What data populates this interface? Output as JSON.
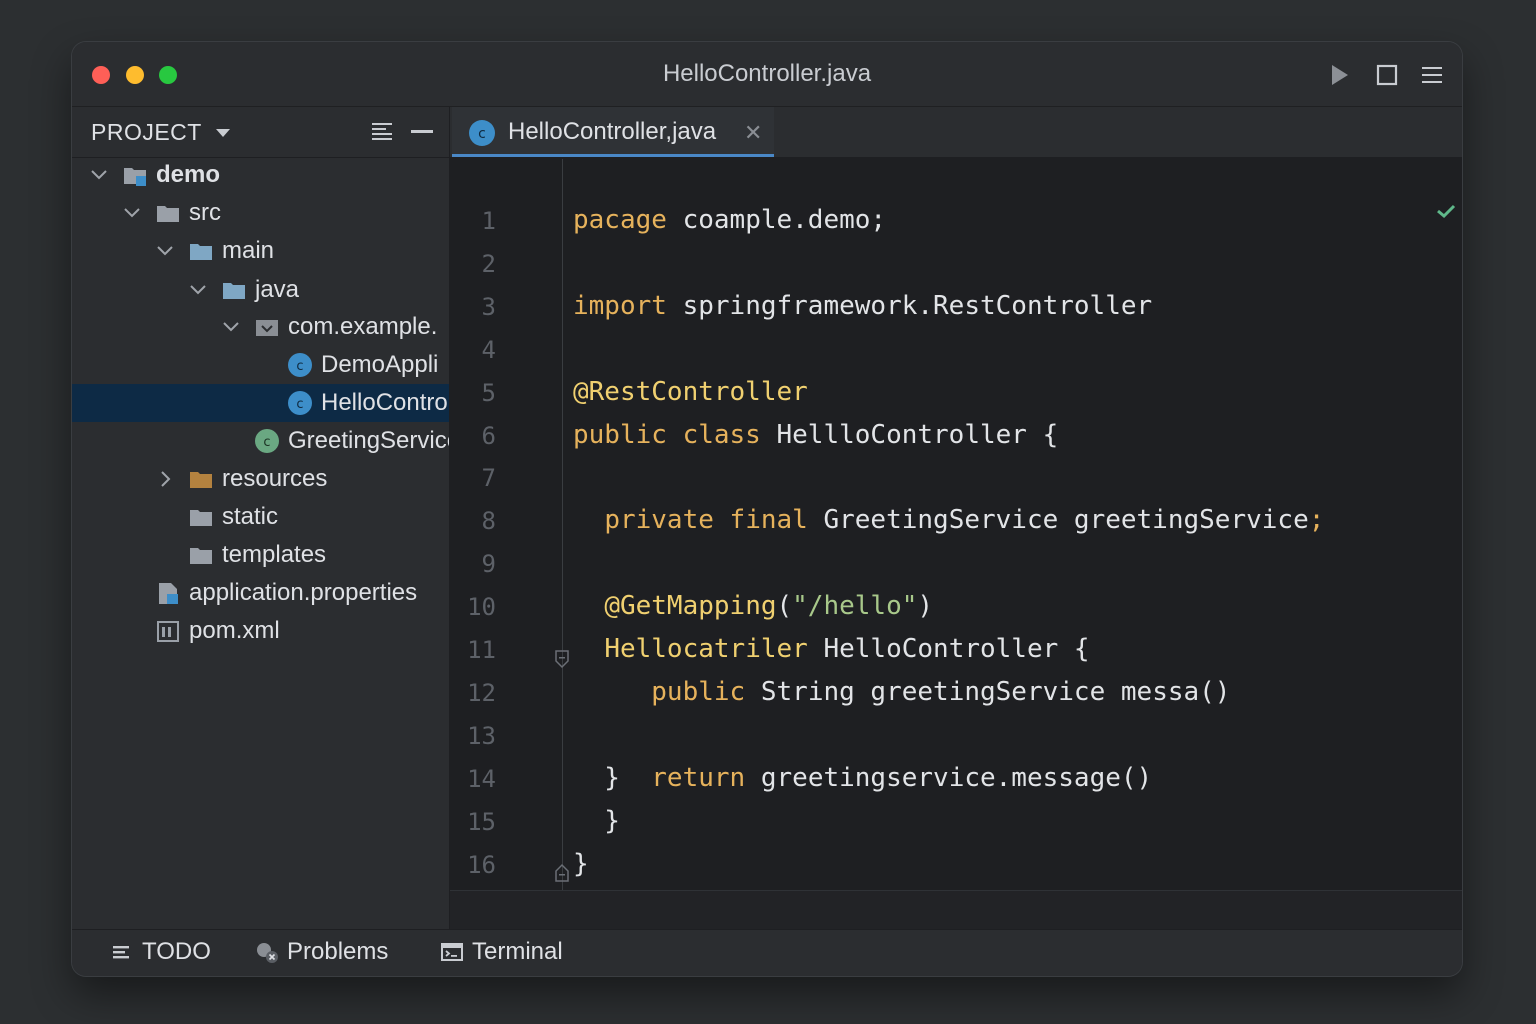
{
  "window": {
    "title": "HelloController.java"
  },
  "sidebar": {
    "title": "PROJECT",
    "tree": [
      {
        "label": "demo",
        "icon": "module-folder-icon",
        "expanded": true,
        "level": 0
      },
      {
        "label": "src",
        "icon": "folder-icon",
        "expanded": true,
        "level": 1
      },
      {
        "label": "main",
        "icon": "source-folder-icon",
        "expanded": true,
        "level": 2
      },
      {
        "label": "java",
        "icon": "source-folder-icon",
        "expanded": true,
        "level": 3
      },
      {
        "label": "com.example.",
        "icon": "package-icon",
        "expanded": true,
        "level": 4
      },
      {
        "label": "DemoAppli",
        "icon": "class-icon",
        "level": 5
      },
      {
        "label": "HelloControlle",
        "icon": "class-icon",
        "level": 5,
        "selected": true
      },
      {
        "label": "GreetingService",
        "icon": "service-class-icon",
        "level": 4
      },
      {
        "label": "resources",
        "icon": "resources-folder-icon",
        "expanded": false,
        "level": 2
      },
      {
        "label": "static",
        "icon": "folder-icon",
        "level": 2
      },
      {
        "label": "templates",
        "icon": "folder-icon",
        "level": 2
      },
      {
        "label": "application.properties",
        "icon": "properties-file-icon",
        "level": 1
      },
      {
        "label": "pom.xml",
        "icon": "maven-file-icon",
        "level": 1
      }
    ]
  },
  "editor": {
    "tab": {
      "label": "HelloController,java",
      "icon": "class-icon",
      "close": "✕"
    },
    "line_numbers": [
      "1",
      "2",
      "3",
      "4",
      "5",
      "6",
      "7",
      "8",
      "9",
      "10",
      "11",
      "12",
      "13",
      "14",
      "15",
      "16"
    ],
    "lines": [
      [
        {
          "t": "pacage",
          "c": "kw"
        },
        {
          "t": " coample.demo;"
        }
      ],
      [],
      [
        {
          "t": "import",
          "c": "kw"
        },
        {
          "t": " springframework.RestController"
        }
      ],
      [],
      [
        {
          "t": "@RestController",
          "c": "an"
        }
      ],
      [
        {
          "t": "public class",
          "c": "kw"
        },
        {
          "t": " HellloController {"
        }
      ],
      [],
      [
        {
          "t": "  "
        },
        {
          "t": "private final",
          "c": "kw"
        },
        {
          "t": " GreetingService greetingService"
        },
        {
          "t": ";",
          "c": "kw"
        }
      ],
      [],
      [
        {
          "t": "  "
        },
        {
          "t": "@GetMapping",
          "c": "an"
        },
        {
          "t": "("
        },
        {
          "t": "\"/hello\"",
          "c": "str"
        },
        {
          "t": ")"
        }
      ],
      [
        {
          "t": "  "
        },
        {
          "t": "Hellocatriler",
          "c": "an"
        },
        {
          "t": " HelloController {"
        }
      ],
      [
        {
          "t": "     "
        },
        {
          "t": "public",
          "c": "kw"
        },
        {
          "t": " String greetingService messa()"
        }
      ],
      [],
      [
        {
          "t": "  }  "
        },
        {
          "t": "return",
          "c": "kw"
        },
        {
          "t": " greetingservice.message()"
        }
      ],
      [
        {
          "t": "  }"
        }
      ],
      [
        {
          "t": "}"
        }
      ]
    ],
    "status": "no-problems-check"
  },
  "bottombar": {
    "items": [
      {
        "label": "TODO",
        "icon": "todo-list-icon"
      },
      {
        "label": "Problems",
        "icon": "problems-icon"
      },
      {
        "label": "Terminal",
        "icon": "terminal-icon"
      }
    ]
  },
  "colors": {
    "keyword": "#e6b25c",
    "annotation": "#f0d070",
    "string": "#a8c88a",
    "selection": "#0d2a45",
    "accent": "#4a88c7"
  }
}
